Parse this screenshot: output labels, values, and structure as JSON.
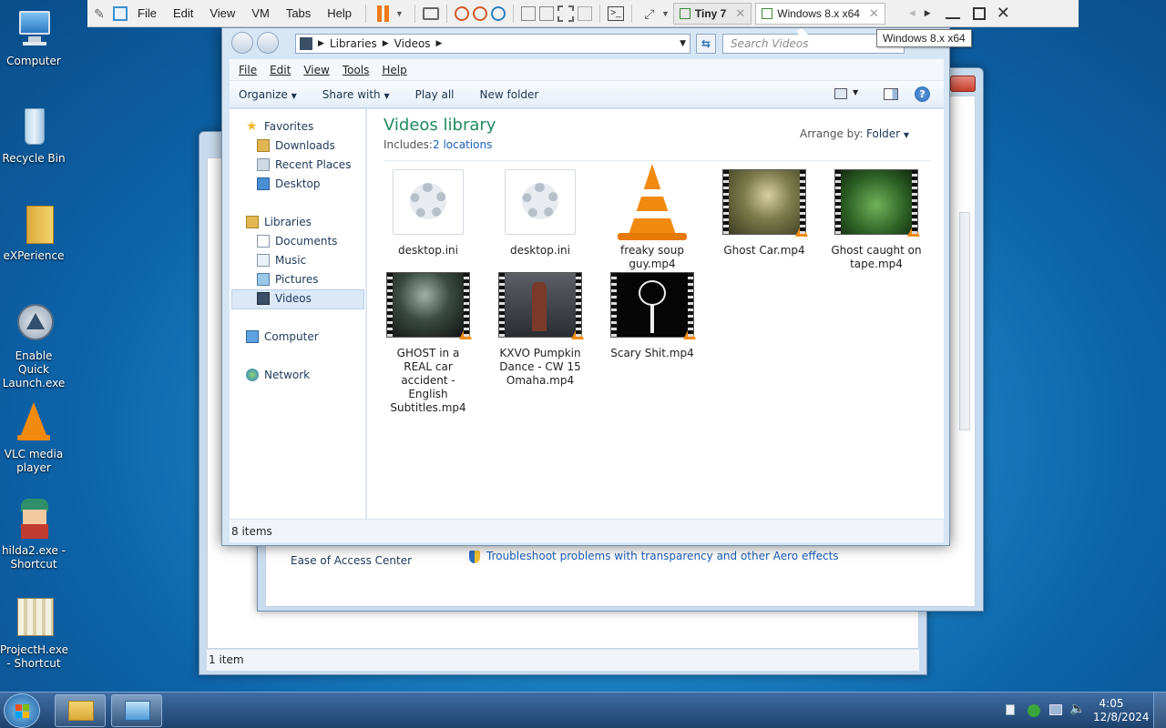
{
  "desktop_icons": [
    {
      "label": "Computer"
    },
    {
      "label": "Recycle Bin"
    },
    {
      "label": "eXPerience"
    },
    {
      "label": "Enable Quick Launch.exe"
    },
    {
      "label": "VLC media player"
    },
    {
      "label": "hilda2.exe - Shortcut"
    },
    {
      "label": "ProjectH.exe - Shortcut"
    }
  ],
  "vmware": {
    "menu": [
      "File",
      "Edit",
      "View",
      "VM",
      "Tabs",
      "Help"
    ],
    "tabs": [
      {
        "label": "Tiny 7"
      },
      {
        "label": "Windows 8.x x64"
      }
    ],
    "tooltip": "Windows 8.x x64"
  },
  "explorer": {
    "breadcrumb": [
      "Libraries",
      "Videos"
    ],
    "search_placeholder": "Search Videos",
    "menu": [
      "File",
      "Edit",
      "View",
      "Tools",
      "Help"
    ],
    "commands": [
      "Organize",
      "Share with",
      "Play all",
      "New folder"
    ],
    "nav": {
      "favorites": "Favorites",
      "fav_items": [
        "Downloads",
        "Recent Places",
        "Desktop"
      ],
      "libraries": "Libraries",
      "lib_items": [
        "Documents",
        "Music",
        "Pictures",
        "Videos"
      ],
      "computer": "Computer",
      "network": "Network"
    },
    "library_title": "Videos library",
    "includes_label": "Includes:",
    "includes_link": "2 locations",
    "arrange_label": "Arrange by:",
    "arrange_value": "Folder",
    "files": [
      {
        "name": "desktop.ini",
        "type": "ini"
      },
      {
        "name": "desktop.ini",
        "type": "ini"
      },
      {
        "name": "freaky soup guy.mp4",
        "type": "vlc"
      },
      {
        "name": "Ghost Car.mp4",
        "type": "video"
      },
      {
        "name": "Ghost caught on tape.mp4",
        "type": "video"
      },
      {
        "name": "GHOST in a REAL car accident - English Subtitles.mp4",
        "type": "video"
      },
      {
        "name": "KXVO Pumpkin Dance - CW 15 Omaha.mp4",
        "type": "video"
      },
      {
        "name": "Scary Shit.mp4",
        "type": "video"
      }
    ],
    "status": "8 items"
  },
  "background_window": {
    "ease_of_access": "Ease of Access Center",
    "troubleshoot": "Troubleshoot problems with transparency and other Aero effects",
    "status": "1 item"
  },
  "tray": {
    "time": "4:05",
    "date": "12/8/2024"
  },
  "colors": {
    "accent": "#1e6ea8",
    "link": "#1c5fb8",
    "title": "#1e8a5c"
  }
}
